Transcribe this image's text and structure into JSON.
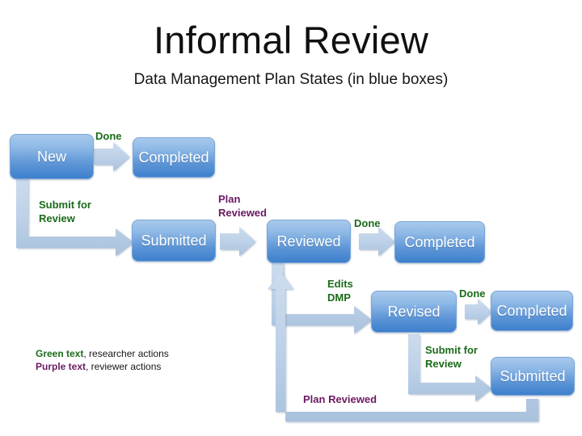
{
  "slide": {
    "title": "Informal Review",
    "subtitle": "Data Management Plan States (in blue boxes)"
  },
  "states": [
    {
      "id": "new",
      "label": "New"
    },
    {
      "id": "completed-1",
      "label": "Completed"
    },
    {
      "id": "submitted-1",
      "label": "Submitted"
    },
    {
      "id": "reviewed",
      "label": "Reviewed"
    },
    {
      "id": "completed-2",
      "label": "Completed"
    },
    {
      "id": "revised",
      "label": "Revised"
    },
    {
      "id": "completed-3",
      "label": "Completed"
    },
    {
      "id": "submitted-2",
      "label": "Submitted"
    }
  ],
  "transitions": [
    {
      "id": "new-done",
      "label": "Done",
      "actor": "researcher"
    },
    {
      "id": "new-submit",
      "label": "Submit for\nReview",
      "actor": "researcher"
    },
    {
      "id": "submitted-reviewed",
      "label": "Plan\nReviewed",
      "actor": "reviewer"
    },
    {
      "id": "reviewed-done",
      "label": "Done",
      "actor": "researcher"
    },
    {
      "id": "reviewed-edits",
      "label": "Edits\nDMP",
      "actor": "researcher"
    },
    {
      "id": "revised-done",
      "label": "Done",
      "actor": "researcher"
    },
    {
      "id": "revised-submit",
      "label": "Submit for\nReview",
      "actor": "researcher"
    },
    {
      "id": "submitted2-reviewed",
      "label": "Plan Reviewed",
      "actor": "reviewer"
    }
  ],
  "legend": {
    "green_key": "Green text",
    "green_desc": ", researcher actions",
    "purple_key": "Purple text",
    "purple_desc": ", reviewer actions"
  },
  "colors": {
    "green": "#1a6b1a",
    "purple": "#6b1a63",
    "box_top": "#a8c9ec",
    "box_bottom": "#3d80cc",
    "connector": "#bdd0e6",
    "background": "#ffffff"
  }
}
